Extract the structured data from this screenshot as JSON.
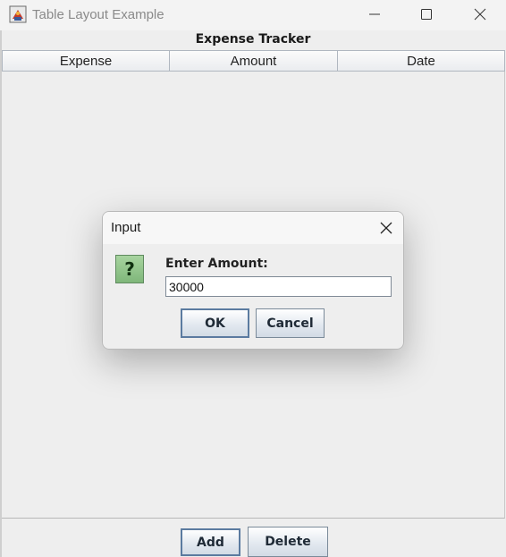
{
  "window": {
    "title": "Table Layout Example",
    "icons": {
      "app": "java-cup-icon",
      "minimize": "minimize-icon",
      "maximize": "maximize-icon",
      "close": "close-icon"
    }
  },
  "main": {
    "header": "Expense Tracker",
    "table": {
      "columns": [
        "Expense",
        "Amount",
        "Date"
      ],
      "rows": []
    },
    "buttons": {
      "add": "Add",
      "delete": "Delete"
    }
  },
  "dialog": {
    "title": "Input",
    "icon": "question-icon",
    "icon_glyph": "?",
    "prompt": "Enter Amount:",
    "input_value": "30000",
    "buttons": {
      "ok": "OK",
      "cancel": "Cancel"
    }
  },
  "colors": {
    "accent_border": "#5b7ba0",
    "question_green": "#7fb77a"
  }
}
